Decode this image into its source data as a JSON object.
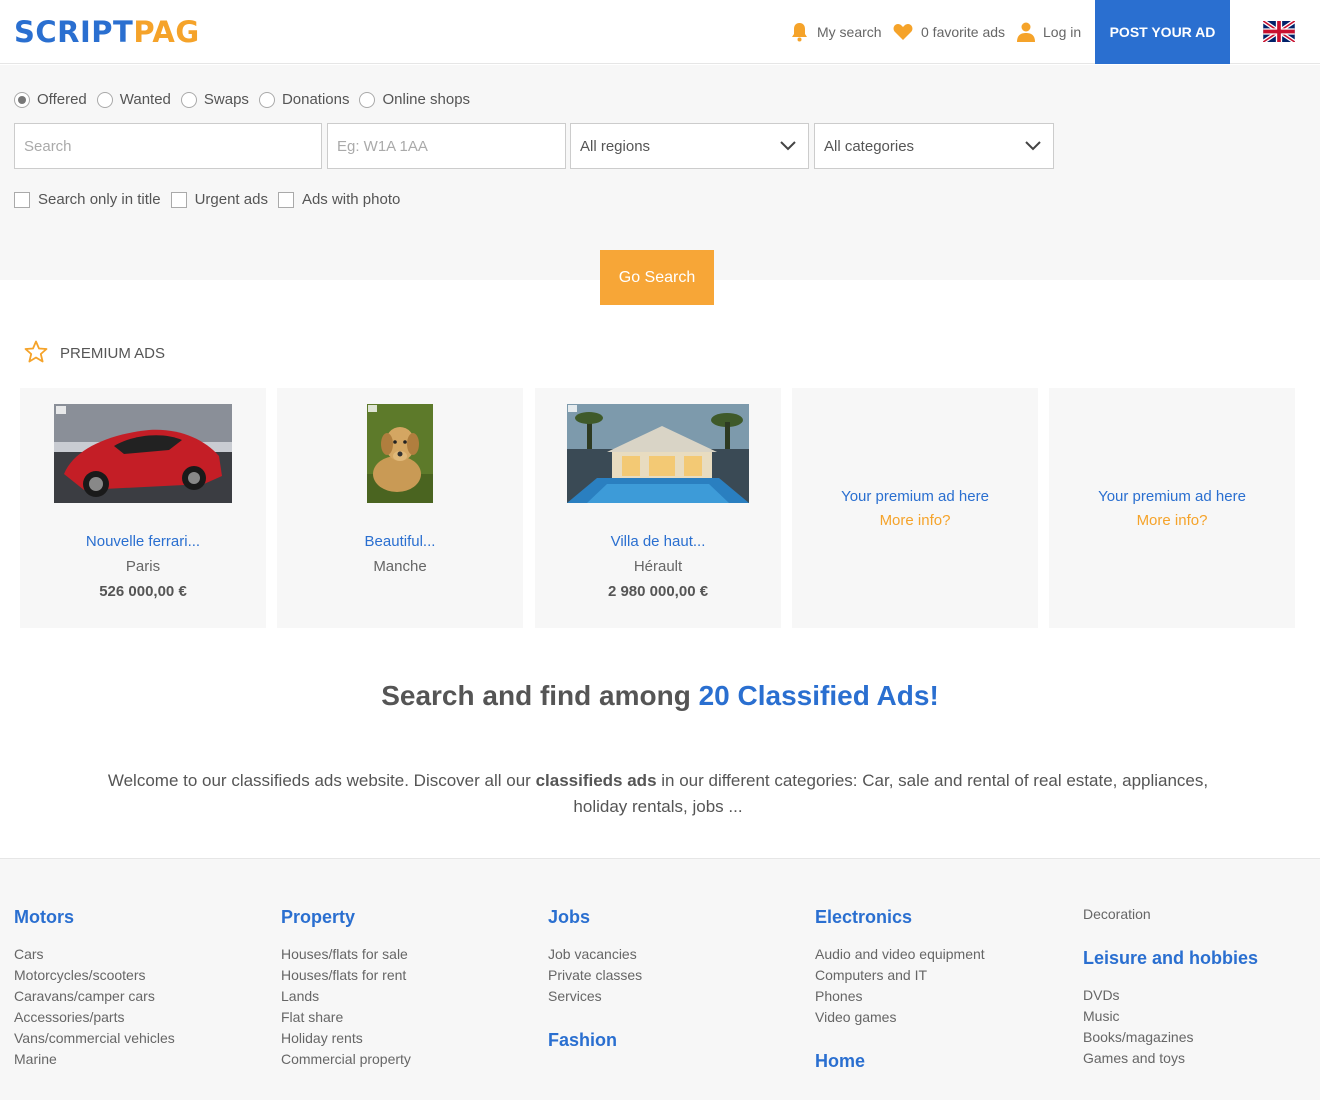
{
  "brand": {
    "part1": "SCRIPT",
    "part2": "PAG",
    "color1": "#2a6fd0",
    "color2": "#f5a32a"
  },
  "header": {
    "my_search": "My search",
    "favorites": "0 favorite ads",
    "login": "Log in",
    "post_ad": "POST YOUR AD",
    "language_icon": "uk-flag-icon"
  },
  "search": {
    "types": [
      "Offered",
      "Wanted",
      "Swaps",
      "Donations",
      "Online shops"
    ],
    "selected_type": "Offered",
    "keyword_placeholder": "Search",
    "postcode_placeholder": "Eg: W1A 1AA",
    "region": "All regions",
    "category": "All categories",
    "options": [
      "Search only in title",
      "Urgent ads",
      "Ads with photo"
    ],
    "go": "Go Search"
  },
  "premium": {
    "heading": "PREMIUM ADS",
    "ads": [
      {
        "title": "Nouvelle ferrari...",
        "location": "Paris",
        "price": "526 000,00 €",
        "image": "red-sports-car"
      },
      {
        "title": "Beautiful...",
        "location": "Manche",
        "price": "",
        "image": "labrador-dog"
      },
      {
        "title": "Villa de haut...",
        "location": "Hérault",
        "price": "2 980 000,00 €",
        "image": "villa-pool"
      }
    ],
    "placeholder_title": "Your premium ad here",
    "placeholder_link": "More info?"
  },
  "headline": {
    "lead": "Search and find among",
    "highlight": "20 Classified Ads!"
  },
  "intro": {
    "before": "Welcome to our classifieds ads website. Discover all our",
    "bold": "classifieds ads",
    "after": "in our different categories: Car, sale and rental of real estate, appliances, holiday rentals, jobs ..."
  },
  "footer": {
    "motors": {
      "title": "Motors",
      "items": [
        "Cars",
        "Motorcycles/scooters",
        "Caravans/camper cars",
        "Accessories/parts",
        "Vans/commercial vehicles",
        "Marine"
      ]
    },
    "property": {
      "title": "Property",
      "items": [
        "Houses/flats for sale",
        "Houses/flats for rent",
        "Lands",
        "Flat share",
        "Holiday rents",
        "Commercial property"
      ]
    },
    "jobs": {
      "title": "Jobs",
      "items": [
        "Job vacancies",
        "Private classes",
        "Services"
      ]
    },
    "fashion": {
      "title": "Fashion"
    },
    "electronics": {
      "title": "Electronics",
      "items": [
        "Audio and video equipment",
        "Computers and IT",
        "Phones",
        "Video games"
      ]
    },
    "home": {
      "title": "Home"
    },
    "decoration": "Decoration",
    "leisure": {
      "title": "Leisure and hobbies",
      "items": [
        "DVDs",
        "Music",
        "Books/magazines",
        "Games and toys"
      ]
    }
  }
}
